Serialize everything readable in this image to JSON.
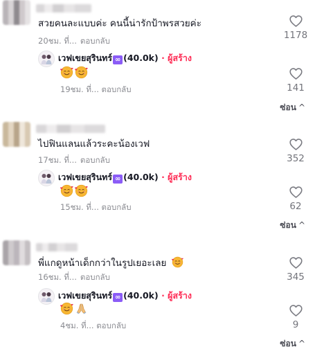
{
  "comments": [
    {
      "text": "สวยคนละแบบค่ะ คนนี้น่ารักป้าพรสวยค่ะ",
      "time": "20ชม. ที่...",
      "reply_label": "ตอบกลับ",
      "likes": "1178",
      "reply": {
        "author": "เวฟเขยสุรินทร์",
        "badge": "∞",
        "followers": "(40.0k)",
        "creator_label": "· ผู้สร้าง",
        "emojis": [
          "smiling-face-with-hearts",
          "smiling-face-with-hearts"
        ],
        "time": "19ชม. ที่...",
        "reply_label": "ตอบกลับ",
        "likes": "141"
      },
      "hide_label": "ซ่อน"
    },
    {
      "text": "ไปฟินแลนแล้วระคะน้องเวฟ",
      "time": "17ชม. ที่...",
      "reply_label": "ตอบกลับ",
      "likes": "352",
      "reply": {
        "author": "เวฟเขยสุรินทร์",
        "badge": "∞",
        "followers": "(40.0k)",
        "creator_label": "· ผู้สร้าง",
        "emojis": [
          "smiling-face-with-hearts",
          "smiling-face-with-hearts"
        ],
        "time": "15ชม. ที่...",
        "reply_label": "ตอบกลับ",
        "likes": "62"
      },
      "hide_label": "ซ่อน"
    },
    {
      "text": "พี่แกดูหน้าเด็กกว่าในรูปเยอะเลย",
      "text_emoji": "smiling-face-with-hearts",
      "time": "16ชม. ที่...",
      "reply_label": "ตอบกลับ",
      "likes": "345",
      "reply": {
        "author": "เวฟเขยสุรินทร์",
        "badge": "∞",
        "followers": "(40.0k)",
        "creator_label": "· ผู้สร้าง",
        "emojis": [
          "smiling-face-with-hearts",
          "folded-hands"
        ],
        "time": "4ชม. ที่...",
        "reply_label": "ตอบกลับ",
        "likes": "9"
      },
      "hide_label": "ซ่อน"
    }
  ]
}
